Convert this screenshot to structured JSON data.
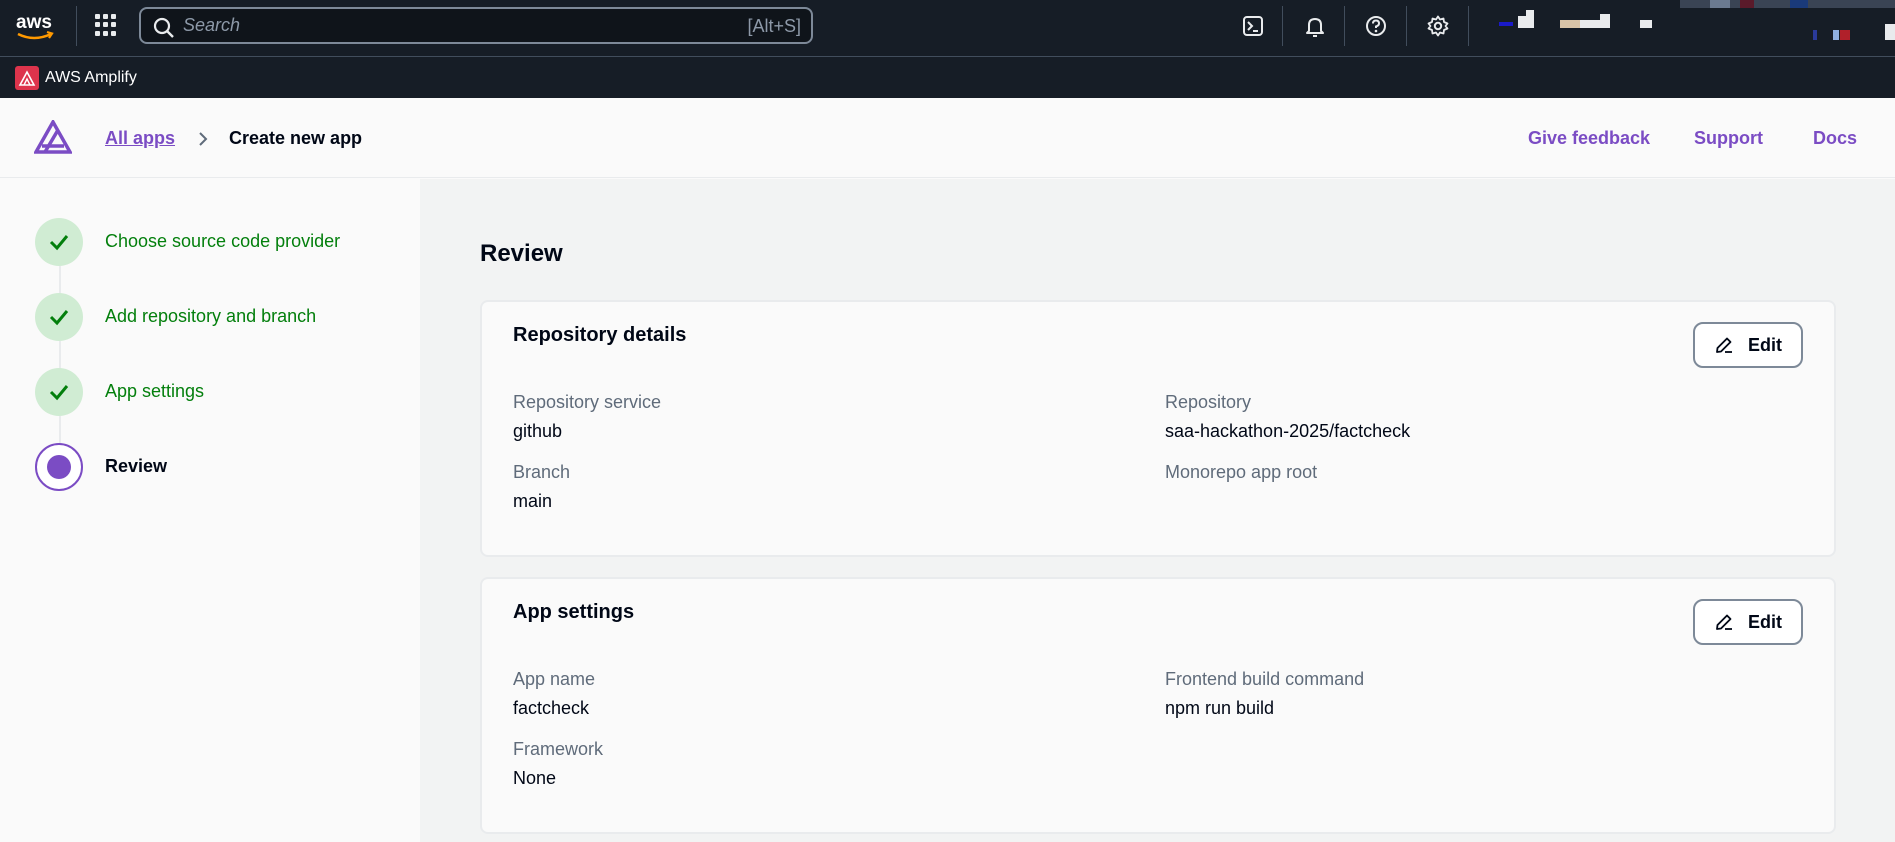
{
  "topnav": {
    "logo_icon": "aws-logo",
    "apps_icon": "apps-grid-icon",
    "search": {
      "placeholder": "Search",
      "shortcut": "[Alt+S]"
    },
    "icons": [
      "cloudshell-icon",
      "bell-icon",
      "help-icon",
      "gear-icon"
    ]
  },
  "servicebar": {
    "label": "AWS Amplify",
    "icon": "amplify-icon",
    "icon_color": "#dd344c"
  },
  "header": {
    "breadcrumb_link": "All apps",
    "breadcrumb_current": "Create new app",
    "links": {
      "feedback": "Give feedback",
      "support": "Support",
      "docs": "Docs"
    }
  },
  "steps": [
    {
      "label": "Choose source code provider",
      "status": "completed"
    },
    {
      "label": "Add repository and branch",
      "status": "completed"
    },
    {
      "label": "App settings",
      "status": "completed"
    },
    {
      "label": "Review",
      "status": "current"
    }
  ],
  "main": {
    "title": "Review",
    "repo_card": {
      "title": "Repository details",
      "edit_label": "Edit",
      "repo_service_label": "Repository service",
      "repo_service_value": "github",
      "repository_label": "Repository",
      "repository_value": "saa-hackathon-2025/factcheck",
      "branch_label": "Branch",
      "branch_value": "main",
      "monorepo_label": "Monorepo app root"
    },
    "app_card": {
      "title": "App settings",
      "edit_label": "Edit",
      "app_name_label": "App name",
      "app_name_value": "factcheck",
      "build_cmd_label": "Frontend build command",
      "build_cmd_value": "npm run build",
      "framework_label": "Framework",
      "framework_value": "None"
    }
  },
  "colors": {
    "accent": "#7b4cc4",
    "success": "#037f0c",
    "success_bg": "#d0ecd3",
    "nav_bg": "#161d26"
  }
}
